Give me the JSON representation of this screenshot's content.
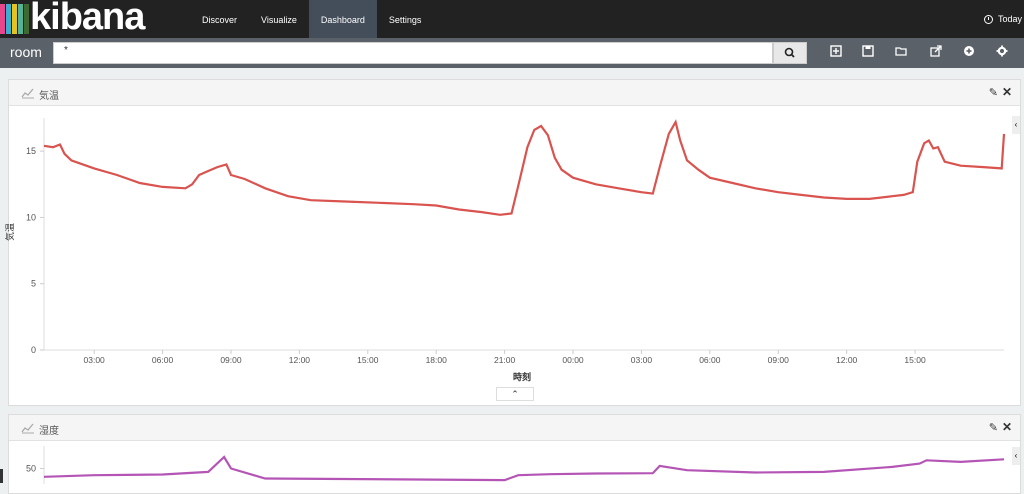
{
  "app": {
    "logo_text": "kibana",
    "logo_colors": [
      "#e8488b",
      "#3caed2",
      "#e6c220",
      "#54b399",
      "#3f6833"
    ]
  },
  "nav": {
    "items": [
      "Discover",
      "Visualize",
      "Dashboard",
      "Settings"
    ],
    "active": "Dashboard"
  },
  "time_picker": {
    "label": "Today"
  },
  "dashboard": {
    "title": "room",
    "query": "*"
  },
  "toolbar": {
    "icons": [
      "new-dashboard-icon",
      "save-icon",
      "open-icon",
      "share-icon",
      "add-visualization-icon",
      "settings-icon"
    ]
  },
  "panels": [
    {
      "title": "気温",
      "icon": "line-chart-icon"
    },
    {
      "title": "湿度",
      "icon": "line-chart-icon"
    }
  ],
  "chart_data": [
    {
      "type": "line",
      "title": "",
      "xlabel": "時刻",
      "ylabel": "気温",
      "ylim": [
        0,
        17.5
      ],
      "yticks": [
        0,
        5,
        10,
        15
      ],
      "xticks": [
        "03:00",
        "06:00",
        "09:00",
        "12:00",
        "15:00",
        "18:00",
        "21:00",
        "00:00",
        "03:00",
        "06:00",
        "09:00",
        "12:00",
        "15:00"
      ],
      "xrange_hours": [
        0.8,
        42.9
      ],
      "color": "#d9534f",
      "series": [
        {
          "values": [
            [
              0.8,
              15.4
            ],
            [
              1.2,
              15.3
            ],
            [
              1.5,
              15.5
            ],
            [
              1.7,
              14.8
            ],
            [
              2.0,
              14.3
            ],
            [
              2.5,
              14.0
            ],
            [
              3.0,
              13.7
            ],
            [
              4.0,
              13.2
            ],
            [
              5.0,
              12.6
            ],
            [
              6.0,
              12.3
            ],
            [
              7.0,
              12.2
            ],
            [
              7.3,
              12.5
            ],
            [
              7.6,
              13.2
            ],
            [
              8.0,
              13.5
            ],
            [
              8.4,
              13.8
            ],
            [
              8.8,
              14.0
            ],
            [
              9.0,
              13.2
            ],
            [
              9.6,
              12.9
            ],
            [
              10.5,
              12.2
            ],
            [
              11.5,
              11.6
            ],
            [
              12.5,
              11.3
            ],
            [
              14.0,
              11.2
            ],
            [
              15.5,
              11.1
            ],
            [
              17.0,
              11.0
            ],
            [
              18.0,
              10.9
            ],
            [
              19.0,
              10.6
            ],
            [
              20.0,
              10.4
            ],
            [
              20.8,
              10.2
            ],
            [
              21.3,
              10.3
            ],
            [
              21.6,
              12.4
            ],
            [
              22.0,
              15.3
            ],
            [
              22.3,
              16.6
            ],
            [
              22.6,
              16.9
            ],
            [
              22.9,
              16.2
            ],
            [
              23.2,
              14.5
            ],
            [
              23.5,
              13.6
            ],
            [
              24.0,
              13.0
            ],
            [
              25.0,
              12.5
            ],
            [
              26.0,
              12.2
            ],
            [
              27.0,
              11.9
            ],
            [
              27.5,
              11.8
            ],
            [
              27.8,
              13.8
            ],
            [
              28.2,
              16.3
            ],
            [
              28.5,
              17.2
            ],
            [
              28.7,
              15.8
            ],
            [
              29.0,
              14.3
            ],
            [
              29.5,
              13.6
            ],
            [
              30.0,
              13.0
            ],
            [
              31.0,
              12.6
            ],
            [
              32.0,
              12.2
            ],
            [
              33.0,
              11.9
            ],
            [
              34.0,
              11.7
            ],
            [
              35.0,
              11.5
            ],
            [
              36.0,
              11.4
            ],
            [
              37.0,
              11.4
            ],
            [
              38.0,
              11.6
            ],
            [
              38.5,
              11.7
            ],
            [
              38.9,
              11.9
            ],
            [
              39.1,
              14.2
            ],
            [
              39.4,
              15.6
            ],
            [
              39.6,
              15.8
            ],
            [
              39.8,
              15.2
            ],
            [
              40.0,
              15.3
            ],
            [
              40.3,
              14.2
            ],
            [
              41.0,
              13.9
            ],
            [
              42.0,
              13.8
            ],
            [
              42.8,
              13.7
            ],
            [
              42.9,
              16.3
            ]
          ]
        }
      ]
    },
    {
      "type": "line",
      "title": "",
      "ylabel": "",
      "ylim": [
        0,
        55
      ],
      "yticks": [
        50
      ],
      "color": "#b455b6",
      "series": [
        {
          "values": [
            [
              0.8,
              47.5
            ],
            [
              3.0,
              48.0
            ],
            [
              6.0,
              48.2
            ],
            [
              8.0,
              49.0
            ],
            [
              8.7,
              53.5
            ],
            [
              9.0,
              50.0
            ],
            [
              10.0,
              48.0
            ],
            [
              10.5,
              47.0
            ],
            [
              21.0,
              46.5
            ],
            [
              21.6,
              48.0
            ],
            [
              23.0,
              48.3
            ],
            [
              25.0,
              48.5
            ],
            [
              27.5,
              48.6
            ],
            [
              27.8,
              50.8
            ],
            [
              29.0,
              49.5
            ],
            [
              32.0,
              48.8
            ],
            [
              35.0,
              49.0
            ],
            [
              38.0,
              50.5
            ],
            [
              39.2,
              51.5
            ],
            [
              39.5,
              52.5
            ],
            [
              41.0,
              52.0
            ],
            [
              42.9,
              52.8
            ]
          ]
        }
      ]
    }
  ]
}
